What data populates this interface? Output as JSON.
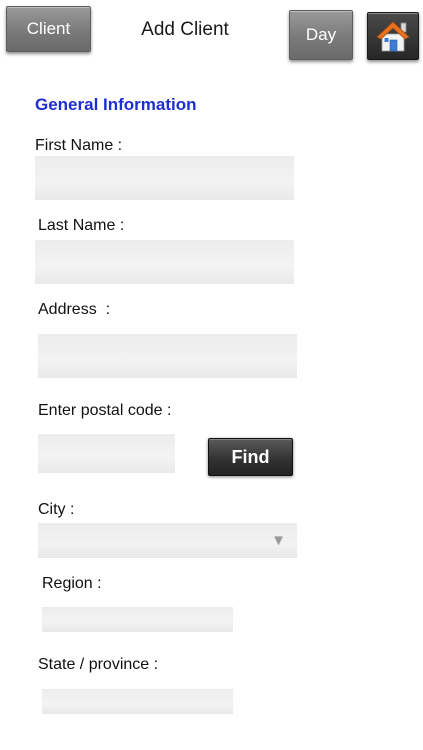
{
  "header": {
    "client_label": "Client",
    "title": "Add Client",
    "day_label": "Day",
    "home_icon": "home-icon"
  },
  "section": {
    "title": "General Information"
  },
  "form": {
    "first_name_label": "First Name :",
    "first_name_value": "",
    "last_name_label": "Last Name :",
    "last_name_value": "",
    "address_label": "Address  :",
    "address_value": "",
    "postal_label": "Enter postal code :",
    "postal_value": "",
    "find_label": "Find",
    "city_label": "City :",
    "city_value": "",
    "city_arrow": "▼",
    "region_label": "Region :",
    "region_value": "",
    "state_label": "State / province :",
    "state_value": ""
  },
  "colors": {
    "section_title": "#1d2fd0",
    "field_bg": "#eeeeee",
    "button_gray": "#8a8a8a",
    "button_dark": "#333333",
    "home_roof": "#e8711f"
  }
}
